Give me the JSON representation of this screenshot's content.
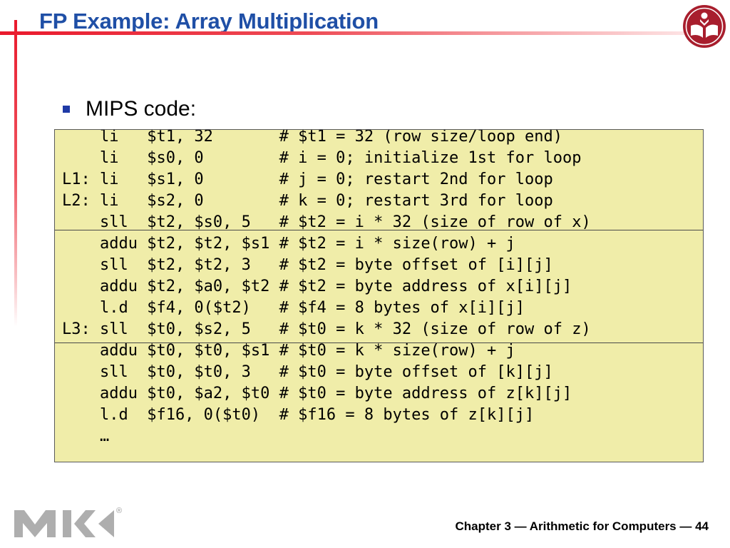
{
  "slide": {
    "title": "FP Example: Array Multiplication",
    "bullet": "MIPS code:",
    "code_lines": [
      "    li   $t1, 32       # $t1 = 32 (row size/loop end)",
      "    li   $s0, 0        # i = 0; initialize 1st for loop",
      "L1: li   $s1, 0        # j = 0; restart 2nd for loop",
      "L2: li   $s2, 0        # k = 0; restart 3rd for loop",
      "    sll  $t2, $s0, 5   # $t2 = i * 32 (size of row of x)",
      "    addu $t2, $t2, $s1 # $t2 = i * size(row) + j",
      "    sll  $t2, $t2, 3   # $t2 = byte offset of [i][j]",
      "    addu $t2, $a0, $t2 # $t2 = byte address of x[i][j]",
      "    l.d  $f4, 0($t2)   # $f4 = 8 bytes of x[i][j]",
      "L3: sll  $t0, $s2, 5   # $t0 = k * 32 (size of row of z)",
      "    addu $t0, $t0, $s1 # $t0 = k * size(row) + j",
      "    sll  $t0, $t0, 3   # $t0 = byte offset of [k][j]",
      "    addu $t0, $a2, $t0 # $t0 = byte address of z[k][j]",
      "    l.d  $f16, 0($t0)  # $f16 = 8 bytes of z[k][j]",
      "    …"
    ],
    "footer": "Chapter 3 — Arithmetic for Computers — 44",
    "registered_mark": "®"
  },
  "colors": {
    "title": "#1f4fa6",
    "accent_red": "#e9192c",
    "code_background": "#f0eda9",
    "logo_gray": "#aeaeae",
    "logo_red": "#a81e2d"
  },
  "icons": {
    "top_right": "university-seal-icon",
    "footer": "publisher-logo-icon"
  }
}
